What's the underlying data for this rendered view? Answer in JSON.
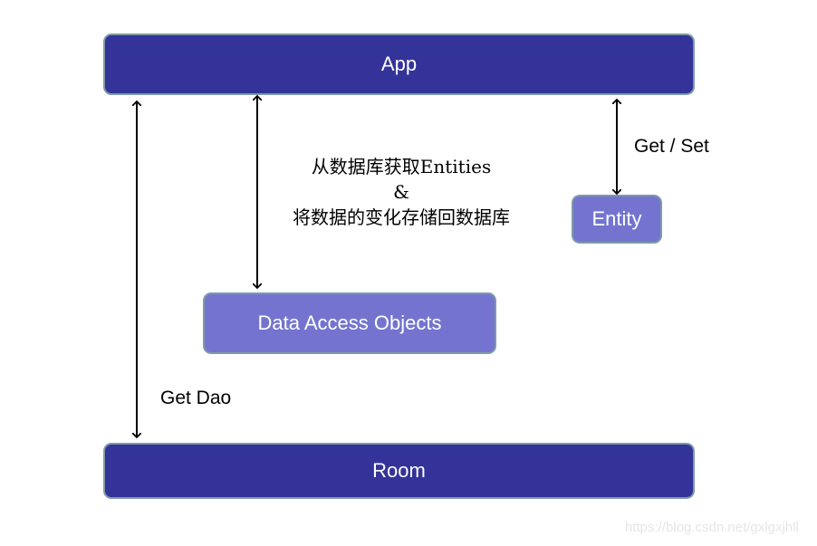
{
  "nodes": {
    "app": "App",
    "room": "Room",
    "dao": "Data Access Objects",
    "entity": "Entity"
  },
  "labels": {
    "get_set": "Get / Set",
    "get_dao": "Get Dao",
    "dao_line1": "从数据库获取Entities",
    "dao_line2": "&",
    "dao_line3": "将数据的变化存储回数据库"
  },
  "colors": {
    "dark_box": "#333399",
    "light_box": "#7474d0",
    "border": "#7f9aa6"
  },
  "watermark": "https://blog.csdn.net/gxlgxjhll"
}
